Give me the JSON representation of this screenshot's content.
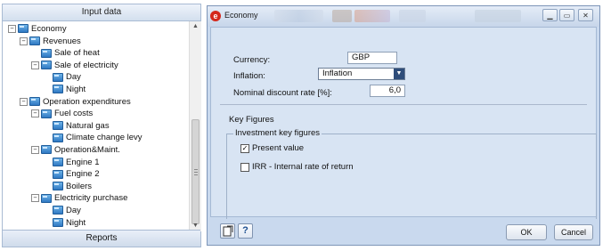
{
  "left_pane": {
    "header": "Input data",
    "footer": "Reports",
    "tree": [
      {
        "label": "Economy",
        "level": 0,
        "toggle": "−"
      },
      {
        "label": "Revenues",
        "level": 1,
        "toggle": "−"
      },
      {
        "label": "Sale of heat",
        "level": 2,
        "toggle": ""
      },
      {
        "label": "Sale of electricity",
        "level": 2,
        "toggle": "−"
      },
      {
        "label": "Day",
        "level": 3,
        "toggle": ""
      },
      {
        "label": "Night",
        "level": 3,
        "toggle": ""
      },
      {
        "label": "Operation expenditures",
        "level": 1,
        "toggle": "−"
      },
      {
        "label": "Fuel costs",
        "level": 2,
        "toggle": "−"
      },
      {
        "label": "Natural gas",
        "level": 3,
        "toggle": ""
      },
      {
        "label": "Climate change levy",
        "level": 3,
        "toggle": ""
      },
      {
        "label": "Operation&Maint.",
        "level": 2,
        "toggle": "−"
      },
      {
        "label": "Engine 1",
        "level": 3,
        "toggle": ""
      },
      {
        "label": "Engine 2",
        "level": 3,
        "toggle": ""
      },
      {
        "label": "Boilers",
        "level": 3,
        "toggle": ""
      },
      {
        "label": "Electricity purchase",
        "level": 2,
        "toggle": "−"
      },
      {
        "label": "Day",
        "level": 3,
        "toggle": ""
      },
      {
        "label": "Night",
        "level": 3,
        "toggle": ""
      }
    ]
  },
  "dialog": {
    "title": "Economy",
    "currency_label": "Currency:",
    "currency_value": "GBP",
    "inflation_label": "Inflation:",
    "inflation_value": "Inflation",
    "discount_label": "Nominal discount rate [%]:",
    "discount_value": "6,0",
    "key_figures_label": "Key Figures",
    "investment_group_label": "Investment key figures",
    "present_value_label": "Present value",
    "present_value_checked": true,
    "irr_label": "IRR - Internal rate of return",
    "irr_checked": false,
    "ok_label": "OK",
    "cancel_label": "Cancel",
    "help_label": "?"
  }
}
